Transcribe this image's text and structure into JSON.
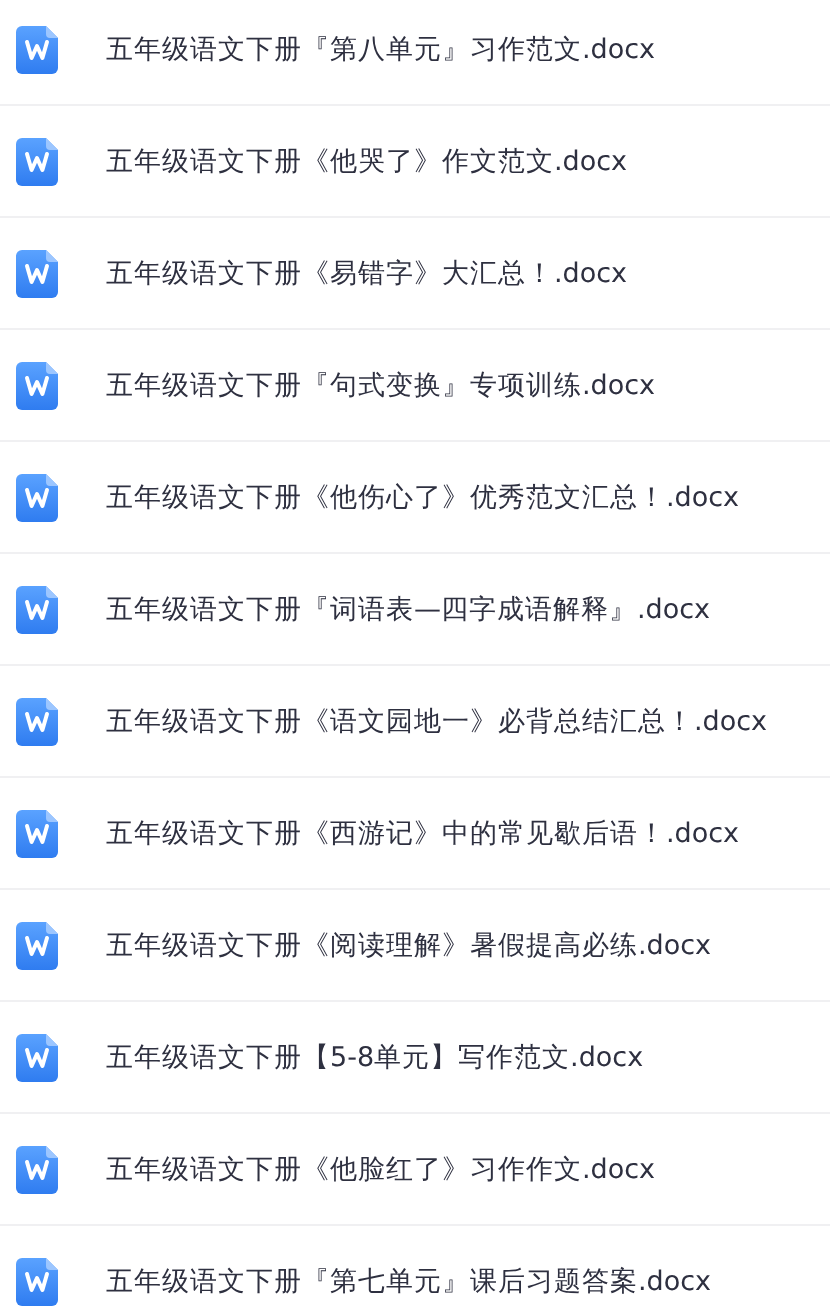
{
  "files": [
    {
      "name": "五年级语文下册『第八单元』习作范文.docx"
    },
    {
      "name": "五年级语文下册《他哭了》作文范文.docx"
    },
    {
      "name": "五年级语文下册《易错字》大汇总！.docx"
    },
    {
      "name": "五年级语文下册『句式变换』专项训练.docx"
    },
    {
      "name": "五年级语文下册《他伤心了》优秀范文汇总！.docx"
    },
    {
      "name": "五年级语文下册『词语表—四字成语解释』.docx"
    },
    {
      "name": "五年级语文下册《语文园地一》必背总结汇总！.docx"
    },
    {
      "name": "五年级语文下册《西游记》中的常见歇后语！.docx"
    },
    {
      "name": "五年级语文下册《阅读理解》暑假提高必练.docx"
    },
    {
      "name": "五年级语文下册【5-8单元】写作范文.docx"
    },
    {
      "name": "五年级语文下册《他脸红了》习作作文.docx"
    },
    {
      "name": "五年级语文下册『第七单元』课后习题答案.docx"
    }
  ]
}
